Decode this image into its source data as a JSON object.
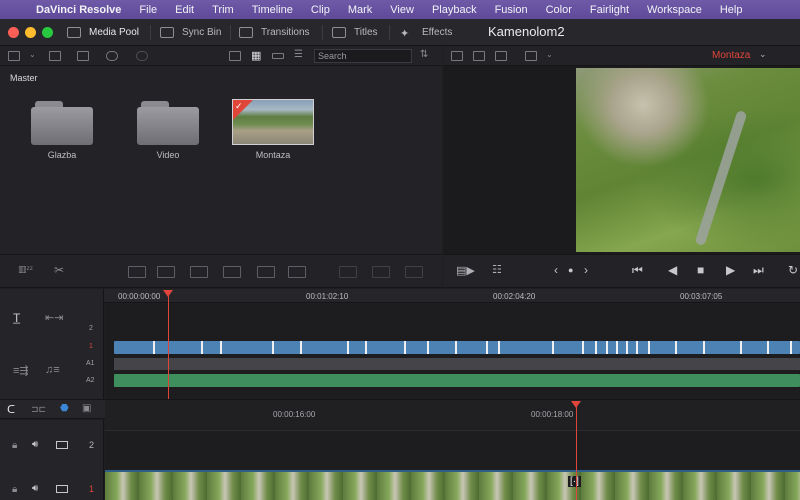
{
  "menubar": {
    "apple": "",
    "items": [
      "DaVinci Resolve",
      "File",
      "Edit",
      "Trim",
      "Timeline",
      "Clip",
      "Mark",
      "View",
      "Playback",
      "Fusion",
      "Color",
      "Fairlight",
      "Workspace",
      "Help"
    ]
  },
  "toolbar": {
    "media_pool": "Media Pool",
    "sync_bin": "Sync Bin",
    "transitions": "Transitions",
    "titles": "Titles",
    "effects": "Effects",
    "project_title": "Kamenolom2"
  },
  "search": {
    "placeholder": "Search"
  },
  "viewer": {
    "timeline_name": "Montaza"
  },
  "media_pool": {
    "bin": "Master",
    "items": [
      {
        "label": "Glazba",
        "type": "folder"
      },
      {
        "label": "Video",
        "type": "folder"
      },
      {
        "label": "Montaza",
        "type": "timeline"
      }
    ]
  },
  "timeline": {
    "timecodes": [
      "00:00:00:00",
      "00:01:02:10",
      "00:02:04:20",
      "00:03:07:05"
    ],
    "tracks": [
      "2",
      "1",
      "A1",
      "A2"
    ],
    "lower_timecodes": [
      "00:00:16:00",
      "00:00:18:00"
    ],
    "lower_tracks": [
      "2",
      "1"
    ]
  },
  "colors": {
    "accent": "#e0453a",
    "clip": "#4d82b4",
    "audio": "#3f8f5e",
    "menubar": "#6650a0"
  }
}
